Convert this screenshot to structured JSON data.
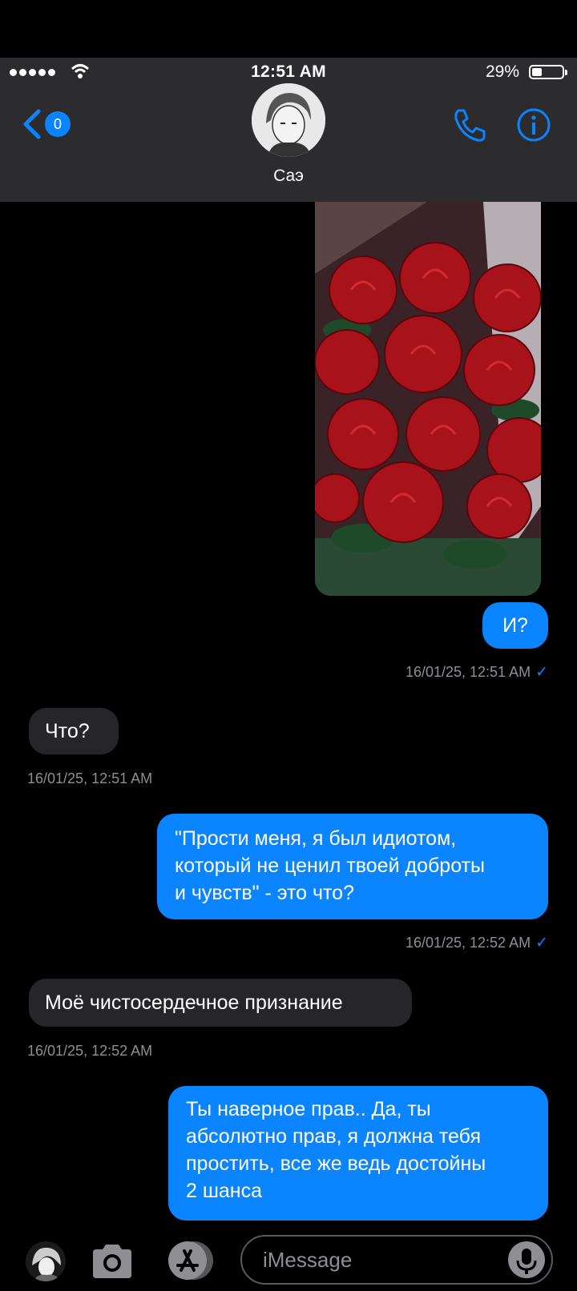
{
  "status_bar": {
    "time": "12:51 AM",
    "battery_percent": "29%",
    "battery_level": 0.29
  },
  "header": {
    "back_count": "0",
    "contact_name": "Саэ"
  },
  "messages": [
    {
      "dir": "out",
      "text": "И?"
    },
    {
      "dir": "meta",
      "text": "16/01/25, 12:51 AM"
    },
    {
      "dir": "in",
      "text": "Что?"
    },
    {
      "dir": "meta",
      "text": "16/01/25, 12:51 AM"
    },
    {
      "dir": "out",
      "lines": [
        "\"Прости меня, я был идиотом,",
        "который не ценил твоей доброты",
        "и чувств\" - это что?"
      ]
    },
    {
      "dir": "meta",
      "text": "16/01/25, 12:52 AM"
    },
    {
      "dir": "in",
      "text": "Моё чистосердечное признание"
    },
    {
      "dir": "meta",
      "text": "16/01/25, 12:52 AM"
    },
    {
      "dir": "out",
      "lines": [
        "Ты наверное прав.. Да, ты",
        "абсолютно прав, я должна тебя",
        "простить, все же ведь достойны",
        "2 шанса"
      ]
    }
  ],
  "input": {
    "placeholder": "iMessage"
  },
  "colors": {
    "accent": "#0a84ff",
    "incoming": "#262628",
    "header_bg": "#2c2c2e"
  },
  "icons": [
    "back-chevron-icon",
    "phone-icon",
    "info-icon",
    "wifi-icon",
    "camera-icon",
    "app-store-icon",
    "mic-icon"
  ]
}
